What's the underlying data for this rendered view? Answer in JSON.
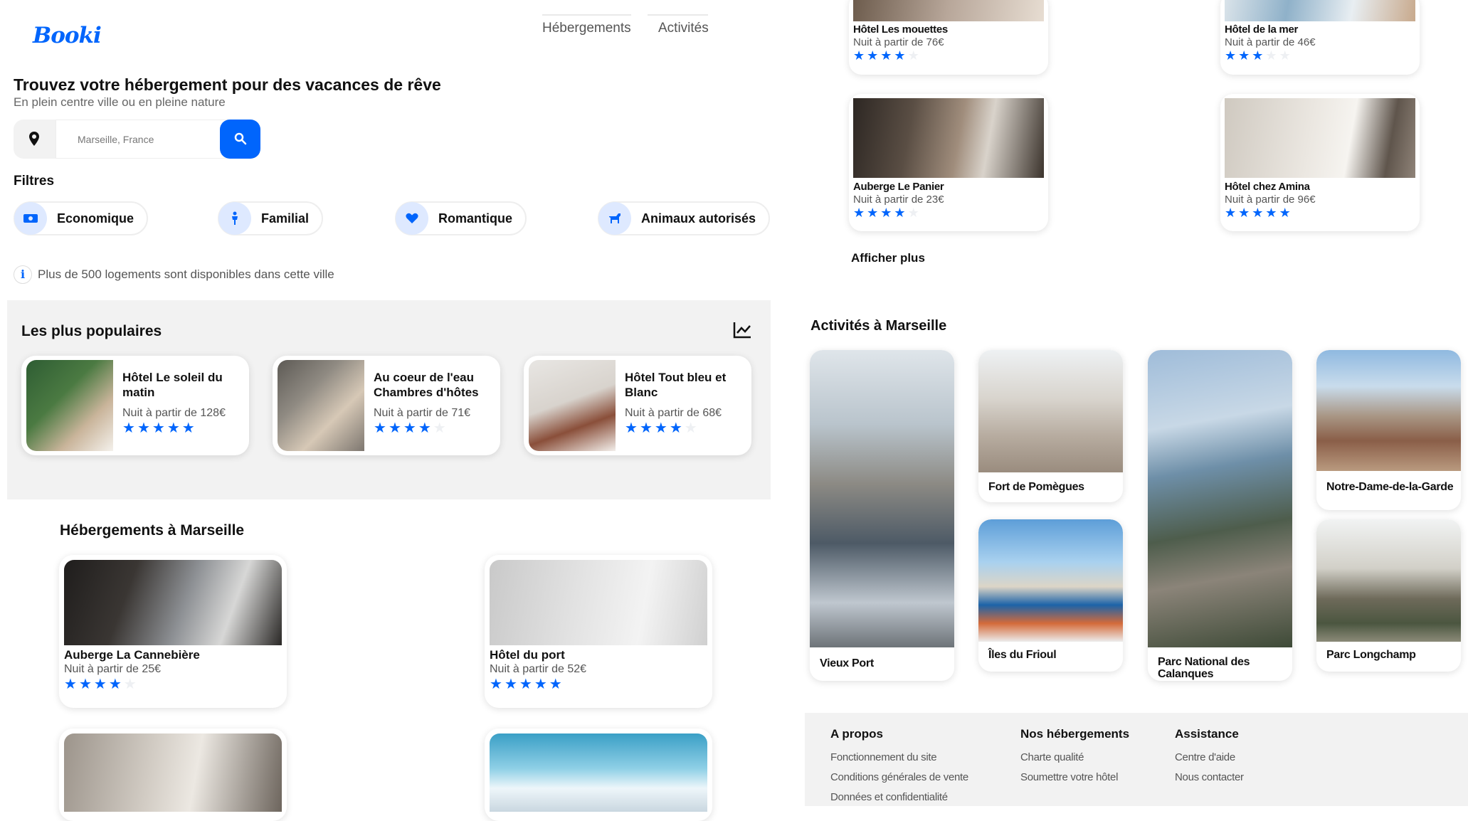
{
  "logo": "Booki",
  "nav": {
    "accommodations": "Hébergements",
    "activities": "Activités"
  },
  "hero": {
    "title": "Trouvez votre hébergement pour des vacances de rêve",
    "subtitle": "En plein centre ville ou en pleine nature"
  },
  "search": {
    "value": "Marseille, France"
  },
  "filters": {
    "title": "Filtres",
    "items": [
      {
        "label": "Economique",
        "icon": "money-icon"
      },
      {
        "label": "Familial",
        "icon": "child-icon"
      },
      {
        "label": "Romantique",
        "icon": "heart-icon"
      },
      {
        "label": "Animaux autorisés",
        "icon": "dog-icon"
      }
    ]
  },
  "info": "Plus de 500 logements sont disponibles dans cette ville",
  "popular": {
    "title": "Les plus populaires",
    "items": [
      {
        "name": "Hôtel Le soleil du matin",
        "price": "Nuit à partir de 128€",
        "rating": 5
      },
      {
        "name": "Au coeur de l'eau Chambres d'hôtes",
        "price": "Nuit à partir de 71€",
        "rating": 4
      },
      {
        "name": "Hôtel Tout bleu et Blanc",
        "price": "Nuit à partir de 68€",
        "rating": 4
      }
    ]
  },
  "accommodations": {
    "title": "Hébergements à Marseille",
    "items": [
      {
        "name": "Auberge La Cannebière",
        "price": "Nuit à partir de 25€",
        "rating": 4
      },
      {
        "name": "Hôtel du port",
        "price": "Nuit à partir de 52€",
        "rating": 5
      }
    ]
  },
  "accommodations_right": {
    "items": [
      {
        "name": "Hôtel Les mouettes",
        "price": "Nuit à partir de 76€",
        "rating": 4
      },
      {
        "name": "Hôtel de la mer",
        "price": "Nuit à partir de 46€",
        "rating": 3
      },
      {
        "name": "Auberge Le Panier",
        "price": "Nuit à partir de 23€",
        "rating": 4
      },
      {
        "name": "Hôtel chez Amina",
        "price": "Nuit à partir de 96€",
        "rating": 5
      }
    ],
    "show_more": "Afficher plus"
  },
  "activities": {
    "title": "Activités à Marseille",
    "items": [
      {
        "name": "Vieux Port"
      },
      {
        "name": "Fort de Pomègues"
      },
      {
        "name": "Îles du Frioul"
      },
      {
        "name": "Parc National des Calanques"
      },
      {
        "name": "Notre-Dame-de-la-Garde"
      },
      {
        "name": "Parc Longchamp"
      }
    ]
  },
  "footer": {
    "about": {
      "title": "A propos",
      "links": [
        "Fonctionnement du site",
        "Conditions générales de vente",
        "Données et confidentialité"
      ]
    },
    "ours": {
      "title": "Nos hébergements",
      "links": [
        "Charte qualité",
        "Soumettre votre hôtel"
      ]
    },
    "help": {
      "title": "Assistance",
      "links": [
        "Centre d'aide",
        "Nous contacter"
      ]
    }
  },
  "colors": {
    "accent": "#0065fc",
    "chip_bg": "#dee9ff",
    "section_bg": "#f2f2f2"
  }
}
